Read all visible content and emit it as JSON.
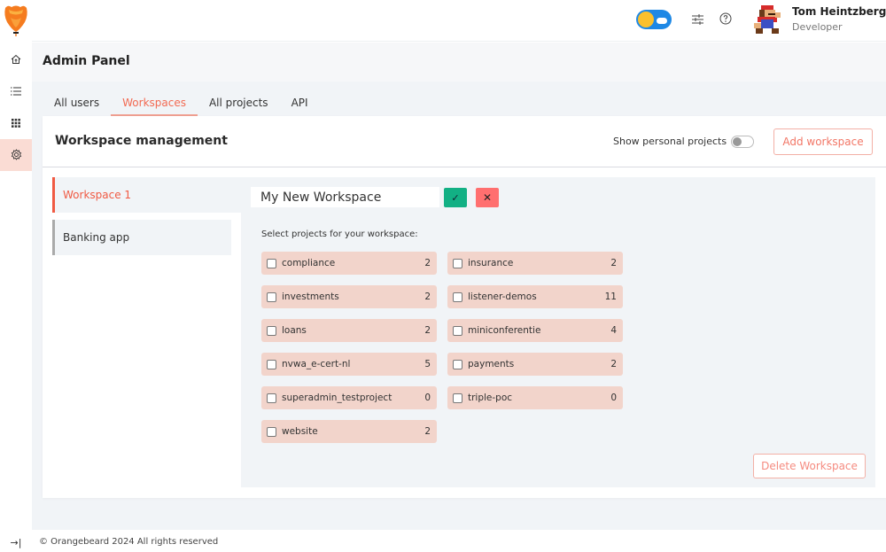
{
  "app": {
    "brand_color": "#f05a43"
  },
  "rail": {
    "items": [
      {
        "icon": "home-icon",
        "active": false
      },
      {
        "icon": "list-icon",
        "active": false
      },
      {
        "icon": "grid-icon",
        "active": false
      },
      {
        "icon": "gear-icon",
        "active": true
      }
    ],
    "collapse_icon": "→|"
  },
  "header": {
    "user_name": "Tom Heintzberger",
    "user_role": "Developer"
  },
  "page": {
    "title": "Admin Panel"
  },
  "tabs": [
    {
      "label": "All users",
      "active": false
    },
    {
      "label": "Workspaces",
      "active": true
    },
    {
      "label": "All projects",
      "active": false
    },
    {
      "label": "API",
      "active": false
    }
  ],
  "card": {
    "title": "Workspace management",
    "show_personal_label": "Show personal projects",
    "show_personal_on": false,
    "add_workspace_label": "Add workspace"
  },
  "workspaces": [
    {
      "name": "Workspace 1",
      "active": true
    },
    {
      "name": "Banking app",
      "active": false
    }
  ],
  "detail": {
    "name_value": "My New Workspace",
    "confirm_icon": "✓",
    "cancel_icon": "✕",
    "select_label": "Select projects for your workspace:",
    "projects": [
      {
        "name": "compliance",
        "count": "2",
        "checked": false
      },
      {
        "name": "insurance",
        "count": "2",
        "checked": false
      },
      {
        "name": "investments",
        "count": "2",
        "checked": false
      },
      {
        "name": "listener-demos",
        "count": "11",
        "checked": false
      },
      {
        "name": "loans",
        "count": "2",
        "checked": false
      },
      {
        "name": "miniconferentie",
        "count": "4",
        "checked": false
      },
      {
        "name": "nvwa_e-cert-nl",
        "count": "5",
        "checked": false
      },
      {
        "name": "payments",
        "count": "2",
        "checked": false
      },
      {
        "name": "superadmin_testproject",
        "count": "0",
        "checked": false
      },
      {
        "name": "triple-poc",
        "count": "0",
        "checked": false
      },
      {
        "name": "website",
        "count": "2",
        "checked": false
      }
    ],
    "delete_label": "Delete Workspace"
  },
  "footer": {
    "text": "© Orangebeard 2024 All rights reserved"
  }
}
